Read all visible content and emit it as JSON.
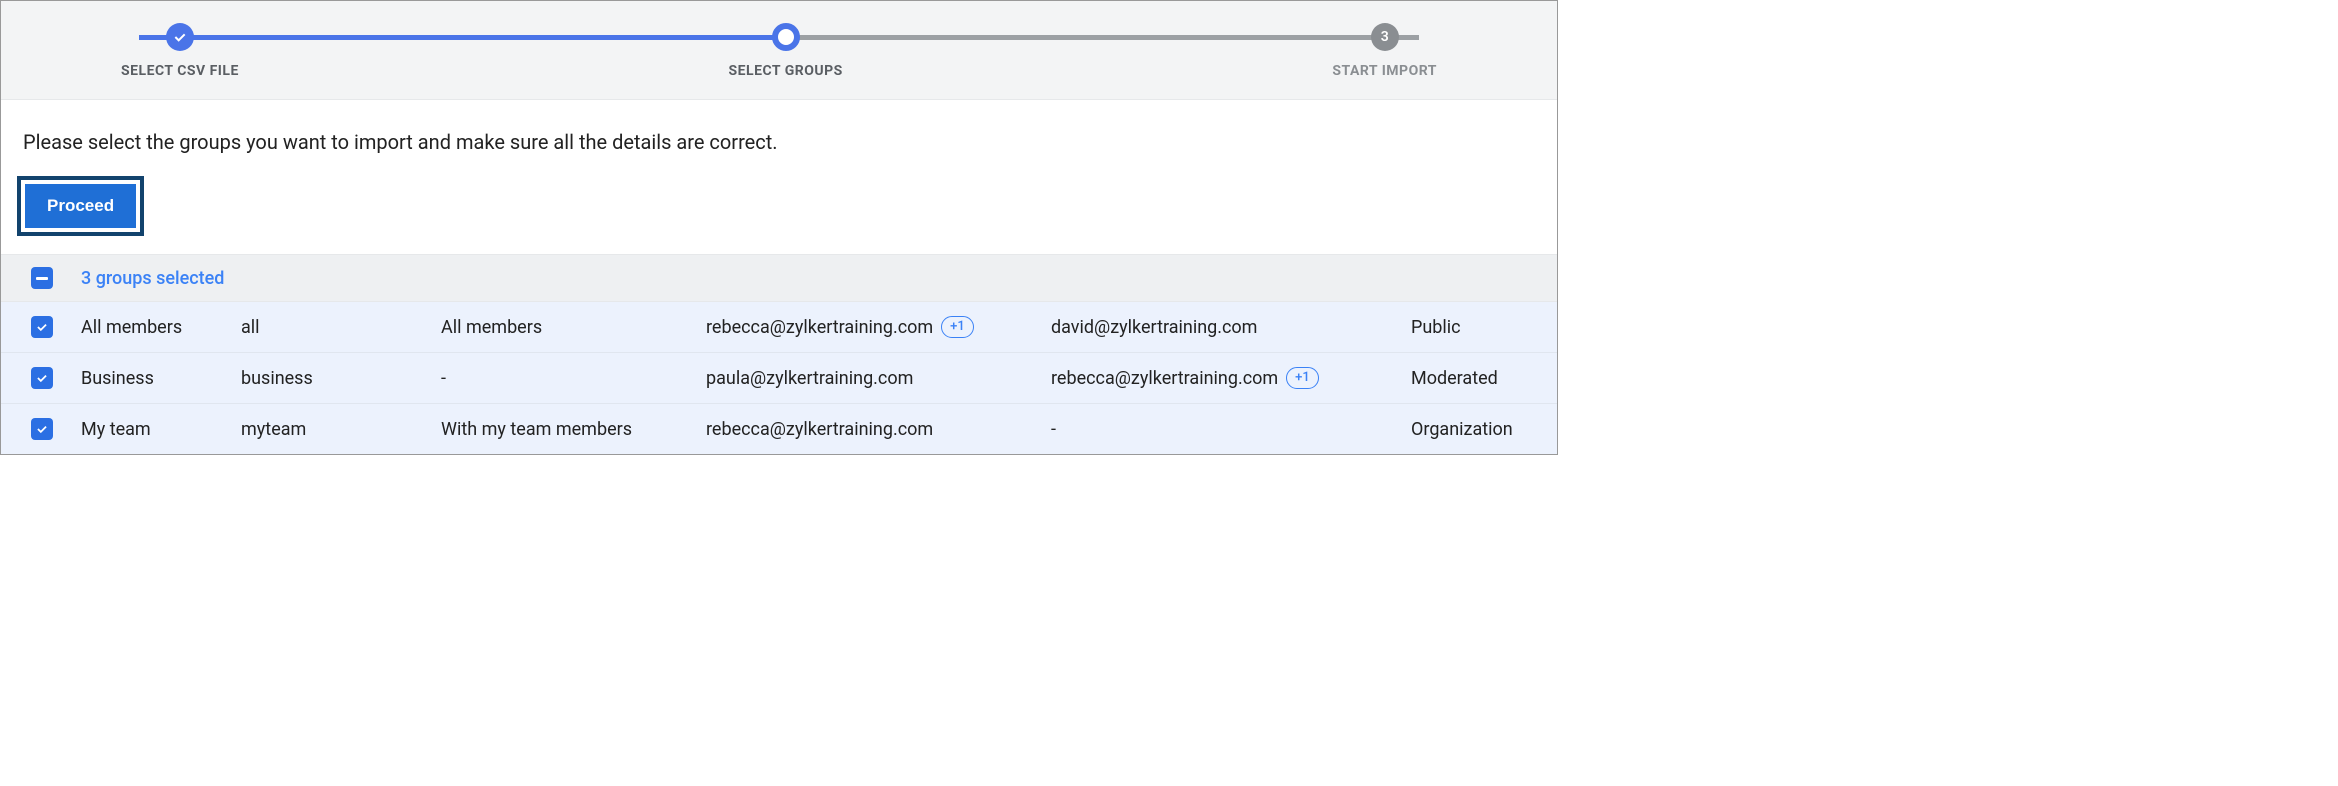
{
  "stepper": {
    "step1": {
      "label": "SELECT CSV FILE"
    },
    "step2": {
      "label": "SELECT GROUPS"
    },
    "step3": {
      "label": "START IMPORT",
      "number": "3"
    }
  },
  "instruction": "Please select the groups you want to import and make sure all the details are correct.",
  "proceed_label": "Proceed",
  "selection_summary": "3 groups selected",
  "rows": [
    {
      "name": "All members",
      "alias": "all",
      "description": "All members",
      "email1": "rebecca@zylkertraining.com",
      "email1_badge": "+1",
      "email2": "david@zylkertraining.com",
      "email2_badge": "",
      "visibility": "Public"
    },
    {
      "name": "Business",
      "alias": "business",
      "description": "-",
      "email1": "paula@zylkertraining.com",
      "email1_badge": "",
      "email2": "rebecca@zylkertraining.com",
      "email2_badge": "+1",
      "visibility": "Moderated"
    },
    {
      "name": "My team",
      "alias": "myteam",
      "description": "With my team members",
      "email1": "rebecca@zylkertraining.com",
      "email1_badge": "",
      "email2": "-",
      "email2_badge": "",
      "visibility": "Organization"
    }
  ]
}
